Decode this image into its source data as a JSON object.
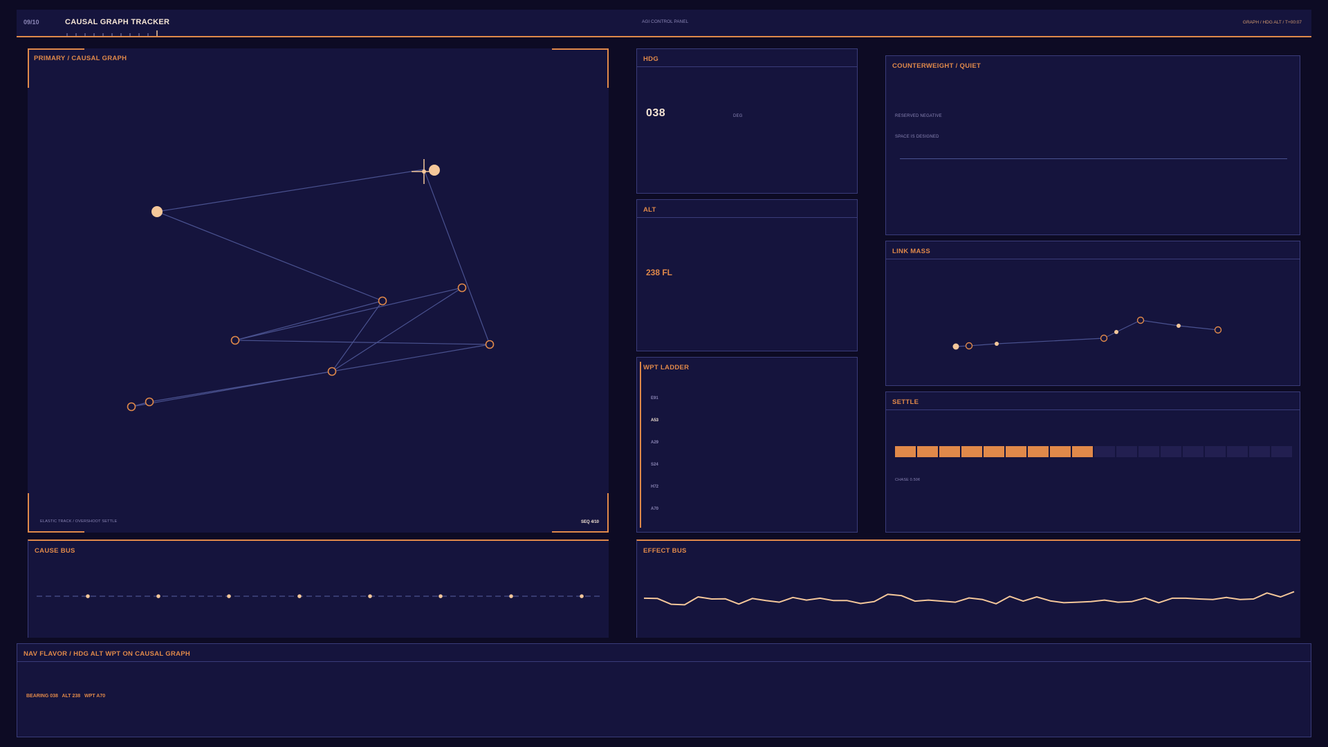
{
  "header": {
    "index": "09/10",
    "title": "CAUSAL GRAPH TRACKER",
    "center": "AGI CONTROL PANEL",
    "right": "GRAPH / HDG ALT / T+00:07"
  },
  "primary": {
    "title_left": "PRIMARY",
    "title_right": "CAUSAL GRAPH",
    "footer_left": "ELASTIC TRACK / OVERSHOOT SETTLE",
    "footer_right": "SEQ 4/10"
  },
  "hdg": {
    "title": "HDG",
    "value": "038",
    "unit": "DEG"
  },
  "alt": {
    "title": "ALT",
    "value": "238 FL"
  },
  "wpt": {
    "title": "WPT LADDER",
    "items": [
      "E91",
      "A53",
      "A29",
      "S24",
      "H72",
      "A70"
    ],
    "active_index": 1
  },
  "counterweight": {
    "title_left": "COUNTERWEIGHT",
    "title_right": "QUIET",
    "line1": "RESERVED NEGATIVE",
    "line2": "SPACE IS DESIGNED"
  },
  "link_mass": {
    "title": "LINK MASS"
  },
  "settle": {
    "title": "SETTLE",
    "segments_total": 18,
    "segments_on": 9,
    "caption": "CHASE 0.50¢"
  },
  "cause_bus": {
    "title": "CAUSE BUS"
  },
  "effect_bus": {
    "title": "EFFECT BUS",
    "series": [
      0.55,
      0.56,
      0.78,
      0.8,
      0.5,
      0.58,
      0.57,
      0.77,
      0.56,
      0.64,
      0.7,
      0.52,
      0.62,
      0.55,
      0.64,
      0.64,
      0.75,
      0.68,
      0.4,
      0.45,
      0.66,
      0.62,
      0.66,
      0.7,
      0.54,
      0.6,
      0.76,
      0.48,
      0.66,
      0.5,
      0.65,
      0.72,
      0.7,
      0.68,
      0.62,
      0.7,
      0.68,
      0.54,
      0.72,
      0.55,
      0.55,
      0.58,
      0.6,
      0.52,
      0.6,
      0.58,
      0.35,
      0.5,
      0.3
    ]
  },
  "nav": {
    "title_left": "NAV FLAVOR",
    "title_right": "HDG ALT WPT ON CAUSAL GRAPH",
    "bearing": "BEARING 038",
    "alt": "ALT 238",
    "wpt": "WPT A70"
  },
  "colors": {
    "bg": "#0d0b24",
    "panel": "#15143d",
    "border": "#3a3c7a",
    "accent": "#e0894a",
    "highlight": "#f4c79a",
    "edge": "#4a5290"
  }
}
